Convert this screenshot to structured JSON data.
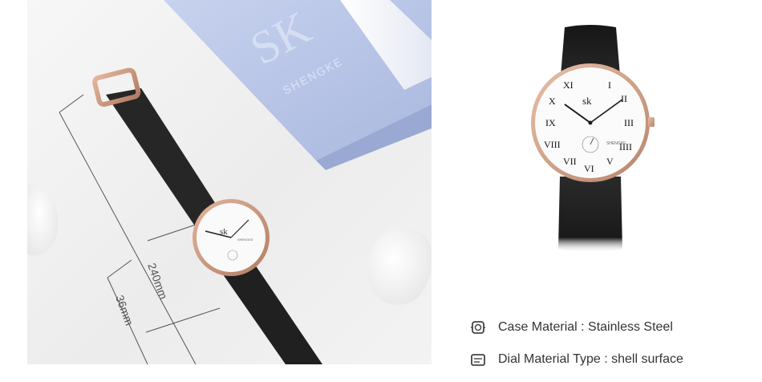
{
  "photo": {
    "box_brand_initials": "SK",
    "box_brand_name": "SHENGKE",
    "dimension_length": "240mm",
    "dimension_case": "36mm",
    "watch_logo": "sk",
    "watch_brand_small": "SHENGKE"
  },
  "product": {
    "watch_logo": "sk",
    "watch_brand_small": "SHENGKE"
  },
  "specs": [
    {
      "icon": "case-icon",
      "label": "Case Material : Stainless Steel"
    },
    {
      "icon": "dial-icon",
      "label": "Dial Material Type : shell surface"
    }
  ],
  "colors": {
    "rose_gold": "#c9957a",
    "strap": "#1f1f1f",
    "box_blue": "#b7c4e6",
    "text": "#333333"
  }
}
